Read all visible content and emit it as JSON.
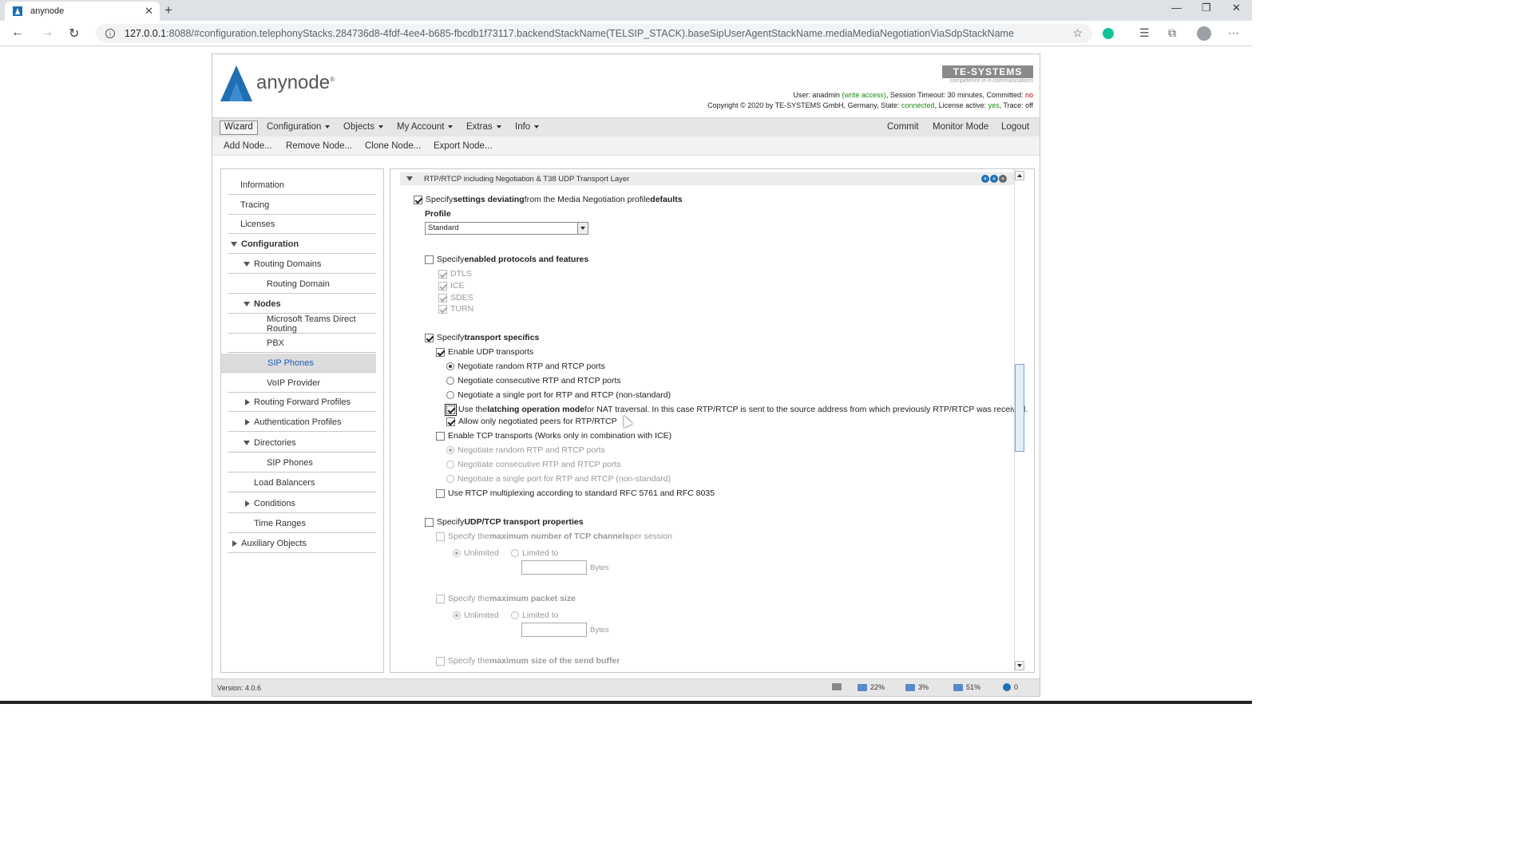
{
  "browser": {
    "tab_title": "anynode",
    "url_host": "127.0.0.1",
    "url_rest": ":8088/#configuration.telephonyStacks.284736d8-4fdf-4ee4-b685-fbcdb1f73117.backendStackName(TELSIP_STACK).baseSipUserAgentStackName.mediaMediaNegotiationViaSdpStackName"
  },
  "header": {
    "logo_text": "anynode",
    "brand": "TE-SYSTEMS",
    "brand_tagline": "competence in e-communications",
    "user_label": "User: ",
    "user": "anadmin",
    "access": "(write access)",
    "timeout": ", Session Timeout: 30 minutes, Committed: ",
    "committed": "no",
    "copyright": "Copyright © 2020 by TE-SYSTEMS GmbH, Germany, State: ",
    "state": "connected",
    "license_label": ", License active: ",
    "license": "yes",
    "trace_label": ", Trace: ",
    "trace": "off"
  },
  "menu": {
    "wizard": "Wizard",
    "configuration": "Configuration",
    "objects": "Objects",
    "my_account": "My Account",
    "extras": "Extras",
    "info": "Info",
    "commit": "Commit",
    "monitor_mode": "Monitor Mode",
    "logout": "Logout"
  },
  "toolbar": {
    "add_node": "Add Node...",
    "remove_node": "Remove Node...",
    "clone_node": "Clone Node...",
    "export_node": "Export Node..."
  },
  "sidebar": {
    "items": [
      {
        "label": "Information"
      },
      {
        "label": "Tracing"
      },
      {
        "label": "Licenses"
      },
      {
        "label": "Configuration"
      },
      {
        "label": "Routing Domains"
      },
      {
        "label": "Routing Domain"
      },
      {
        "label": "Nodes"
      },
      {
        "label": "Microsoft Teams Direct Routing"
      },
      {
        "label": "PBX"
      },
      {
        "label": "SIP Phones"
      },
      {
        "label": "VoIP Provider"
      },
      {
        "label": "Routing Forward Profiles"
      },
      {
        "label": "Authentication Profiles"
      },
      {
        "label": "Directories"
      },
      {
        "label": "SIP Phones"
      },
      {
        "label": "Load Balancers"
      },
      {
        "label": "Conditions"
      },
      {
        "label": "Time Ranges"
      },
      {
        "label": "Auxiliary Objects"
      }
    ]
  },
  "section": {
    "title": "RTP/RTCP including Negotiation & T38 UDP Transport Layer",
    "deviating_a": "Specify ",
    "deviating_b": "settings deviating",
    "deviating_c": " from the Media Negotiation profile ",
    "deviating_d": "defaults",
    "profile_label": "Profile",
    "profile_value": "Standard",
    "protocols_a": "Specify ",
    "protocols_b": "enabled protocols and features",
    "dtls": "DTLS",
    "ice": "ICE",
    "sdes": "SDES",
    "turn": "TURN",
    "transport_a": "Specify ",
    "transport_b": "transport specifics",
    "enable_udp": "Enable UDP transports",
    "udp_random": "Negotiate random RTP and RTCP ports",
    "udp_consecutive": "Negotiate consecutive RTP and RTCP ports",
    "udp_single": "Negotiate a single port for RTP and RTCP (non-standard)",
    "latching_a": "Use the ",
    "latching_b": "latching operation mode",
    "latching_c": " for NAT traversal. In this case RTP/RTCP is sent to the source address from which previously RTP/RTCP was received.",
    "allow_peers": "Allow only negotiated peers for RTP/RTCP",
    "enable_tcp": "Enable TCP transports (Works only in combination with ICE)",
    "tcp_random": "Negotiate random RTP and RTCP ports",
    "tcp_consecutive": "Negotiate consecutive RTP and RTCP ports",
    "tcp_single": "Negotiate a single port for RTP and RTCP (non-standard)",
    "rtcp_mux": "Use RTCP multiplexing according to standard RFC 5761 and RFC 8035",
    "udptcp_a": "Specify ",
    "udptcp_b": "UDP/TCP transport properties",
    "max_tcp_a": "Specify the ",
    "max_tcp_b": "maximum number of TCP channels",
    "max_tcp_c": " per session",
    "unlimited": "Unlimited",
    "limited_to": "Limited to",
    "bytes": "Bytes",
    "max_packet_a": "Specify the ",
    "max_packet_b": "maximum packet size",
    "max_send_a": "Specify the ",
    "max_send_b": "maximum size of the send buffer"
  },
  "footer": {
    "version": "Version: 4.0.6",
    "cpu": "22%",
    "mem": "3%",
    "disk": "51%",
    "conn": "0"
  }
}
